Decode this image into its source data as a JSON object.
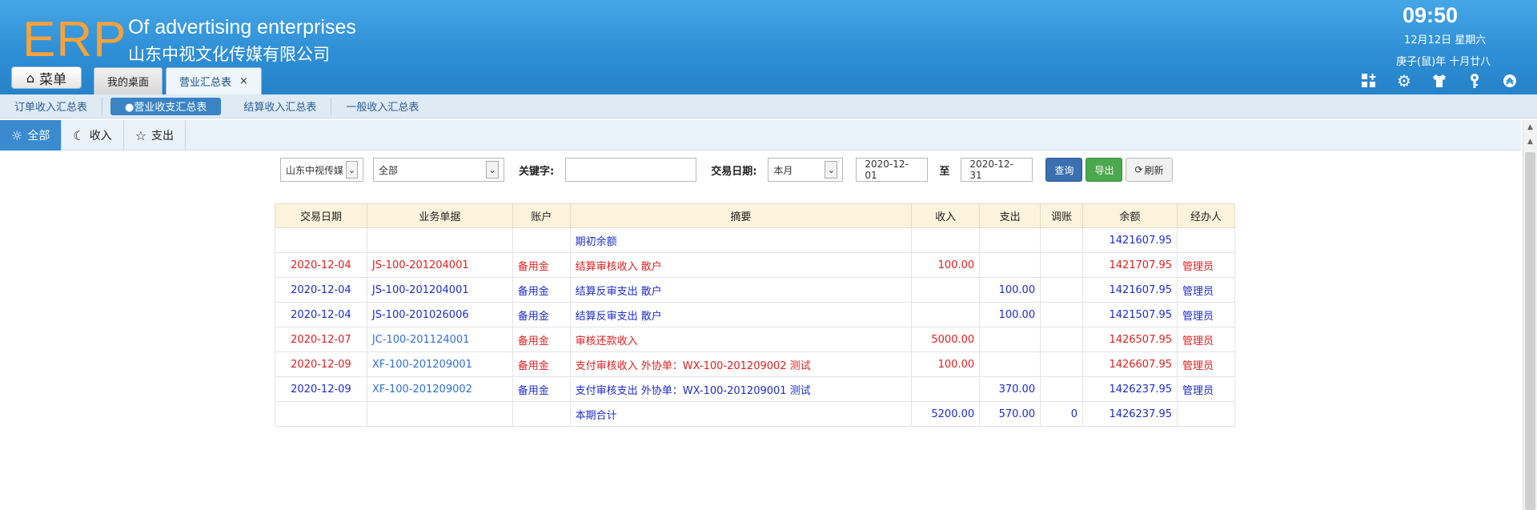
{
  "header": {
    "logo": "ERP",
    "brand_en": "Of advertising enterprises",
    "brand_cn": "山东中视文化传媒有限公司",
    "time": "09:50",
    "date": "12月12日 星期六",
    "lunar": "庚子(鼠)年 十月廿八",
    "menu_label": "菜单",
    "tabs": [
      {
        "label": "我的桌面"
      },
      {
        "label": "营业汇总表",
        "close": "×"
      }
    ],
    "icons": [
      "grid-add-icon",
      "gear-icon",
      "shirt-icon",
      "key-icon",
      "chevron-up-circle-icon"
    ]
  },
  "subnav": {
    "items": [
      "订单收入汇总表",
      "●营业收支汇总表",
      "结算收入汇总表",
      "一般收入汇总表"
    ],
    "active_index": 1
  },
  "filter_tabs": [
    {
      "label": "全部",
      "icon": "sun-icon"
    },
    {
      "label": "收入",
      "icon": "moon-icon"
    },
    {
      "label": "支出",
      "icon": "star-icon"
    }
  ],
  "search": {
    "company": "山东中视传媒",
    "type": "全部",
    "keyword_label": "关键字:",
    "keyword_value": "",
    "date_label": "交易日期:",
    "period": "本月",
    "start_date": "2020-12-01",
    "to_label": "至",
    "end_date": "2020-12-31",
    "query_label": "查询",
    "export_label": "导出",
    "refresh_label": "刷新"
  },
  "table": {
    "headers": [
      "交易日期",
      "业务单据",
      "账户",
      "摘要",
      "收入",
      "支出",
      "调账",
      "余额",
      "经办人"
    ],
    "rows": [
      {
        "color": "blue",
        "date": "",
        "doc": "",
        "account": "",
        "summary": "期初余额",
        "income": "",
        "expense": "",
        "adjust": "",
        "balance": "1421607.95",
        "handler": ""
      },
      {
        "color": "red",
        "date": "2020-12-04",
        "doc": "JS-100-201204001",
        "account": "备用金",
        "summary": "结算审核收入 散户",
        "income": "100.00",
        "expense": "",
        "adjust": "",
        "balance": "1421707.95",
        "handler": "管理员"
      },
      {
        "color": "blue",
        "date": "2020-12-04",
        "doc": "JS-100-201204001",
        "account": "备用金",
        "summary": "结算反审支出 散户",
        "income": "",
        "expense": "100.00",
        "adjust": "",
        "balance": "1421607.95",
        "handler": "管理员"
      },
      {
        "color": "blue",
        "date": "2020-12-04",
        "doc": "JS-100-201026006",
        "account": "备用金",
        "summary": "结算反审支出 散户",
        "income": "",
        "expense": "100.00",
        "adjust": "",
        "balance": "1421507.95",
        "handler": "管理员"
      },
      {
        "color": "red",
        "date": "2020-12-07",
        "doc": "JC-100-201124001",
        "account": "备用金",
        "summary": "审核还款收入",
        "income": "5000.00",
        "expense": "",
        "adjust": "",
        "balance": "1426507.95",
        "handler": "管理员"
      },
      {
        "color": "red",
        "date": "2020-12-09",
        "doc": "XF-100-201209001",
        "account": "备用金",
        "summary": "支付审核收入 外协单：WX-100-201209002 测试",
        "income": "100.00",
        "expense": "",
        "adjust": "",
        "balance": "1426607.95",
        "handler": "管理员"
      },
      {
        "color": "blue",
        "date": "2020-12-09",
        "doc": "XF-100-201209002",
        "account": "备用金",
        "summary": "支付审核支出 外协单：WX-100-201209001 测试",
        "income": "",
        "expense": "370.00",
        "adjust": "",
        "balance": "1426237.95",
        "handler": "管理员"
      },
      {
        "color": "blue",
        "date": "",
        "doc": "",
        "account": "",
        "summary": "本期合计",
        "income": "5200.00",
        "expense": "570.00",
        "adjust": "0",
        "balance": "1426237.95",
        "handler": ""
      }
    ]
  }
}
